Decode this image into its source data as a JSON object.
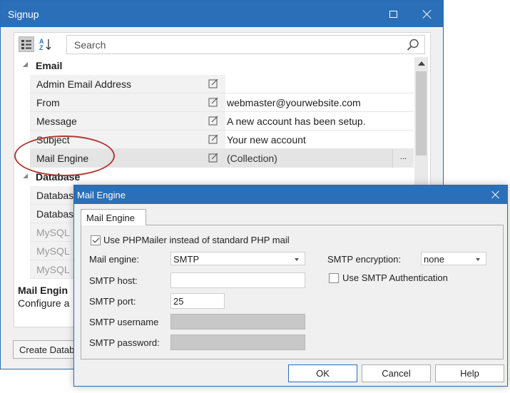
{
  "signup_window": {
    "title": "Signup",
    "search": {
      "placeholder": "Search"
    },
    "categories": [
      {
        "label": "Email"
      },
      {
        "label": "Database"
      }
    ],
    "email_props": [
      {
        "name": "Admin Email Address",
        "value": ""
      },
      {
        "name": "From",
        "value": "webmaster@yourwebsite.com"
      },
      {
        "name": "Message",
        "value": "A new account has been setup."
      },
      {
        "name": "Subject",
        "value": "Your new account"
      },
      {
        "name": "Mail Engine",
        "value": "(Collection)",
        "ellipsis": "..."
      }
    ],
    "database_props": [
      {
        "name": "Databas"
      },
      {
        "name": "Databas"
      },
      {
        "name": "MySQL"
      },
      {
        "name": "MySQL"
      },
      {
        "name": "MySQL"
      }
    ],
    "description": {
      "title": "Mail Engin",
      "text": "Configure a"
    },
    "create_button": "Create Datab"
  },
  "mail_dialog": {
    "title": "Mail Engine",
    "tab": "Mail Engine",
    "use_phpmailer": {
      "label": "Use PHPMailer instead of standard PHP mail",
      "checked": true
    },
    "mail_engine": {
      "label": "Mail engine:",
      "value": "SMTP"
    },
    "smtp_encryption": {
      "label": "SMTP encryption:",
      "value": "none"
    },
    "smtp_host": {
      "label": "SMTP host:",
      "value": ""
    },
    "use_smtp_auth": {
      "label": "Use SMTP Authentication",
      "checked": false
    },
    "smtp_port": {
      "label": "SMTP port:",
      "value": "25"
    },
    "smtp_username": {
      "label": "SMTP username",
      "value": ""
    },
    "smtp_password": {
      "label": "SMTP password:",
      "value": ""
    },
    "buttons": {
      "ok": "OK",
      "cancel": "Cancel",
      "help": "Help"
    }
  },
  "colors": {
    "titlebar": "#2b6fb8",
    "highlight_ellipse": "#b13b35"
  }
}
